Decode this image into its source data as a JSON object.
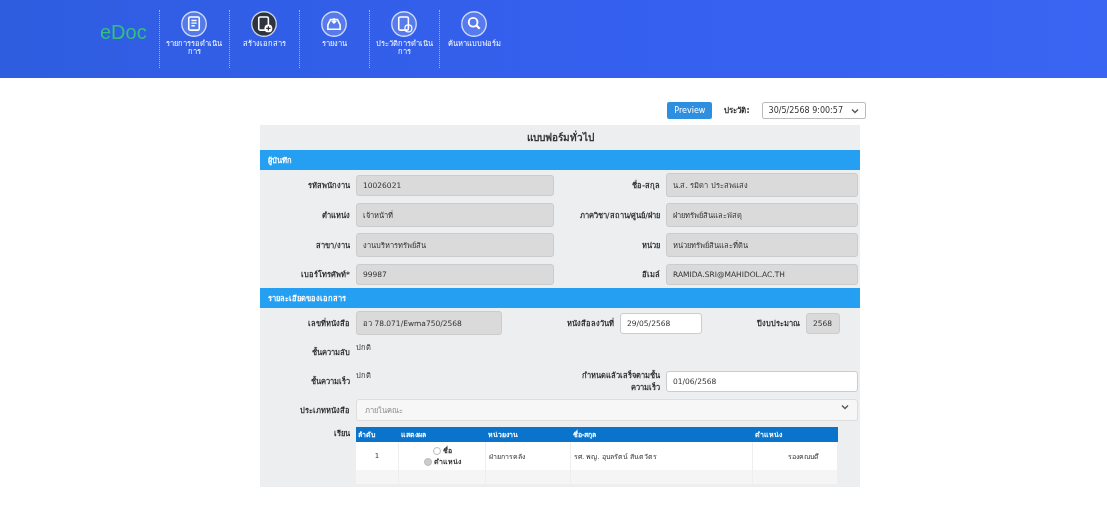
{
  "header": {
    "logo": "eDoc",
    "nav": [
      {
        "label": "รายการรอดำเนินการ",
        "selected": false
      },
      {
        "label": "สร้างเอกสาร",
        "selected": true
      },
      {
        "label": "รายงาน",
        "selected": false
      },
      {
        "label": "ประวัติการดำเนินการ",
        "selected": false
      },
      {
        "label": "ค้นหาแบบฟอร์ม",
        "selected": false
      }
    ]
  },
  "toolbar": {
    "preview_button": "Preview",
    "history_label": "ประวัติ:",
    "history_value": "30/5/2568 9:00:57"
  },
  "form": {
    "title": "แบบฟอร์มทั่วไป",
    "sections": [
      {
        "heading": "ผู้บันทึก",
        "rows": [
          {
            "kind": "fields",
            "items": [
              {
                "label": "รหัสพนักงาน",
                "value": "10026021",
                "kind": "readonly"
              },
              {
                "label": "ชื่อ-สกุล",
                "value": "น.ส. รมิดา ประสพแสง",
                "kind": "readonly"
              }
            ]
          },
          {
            "kind": "fields",
            "items": [
              {
                "label": "ตำแหน่ง",
                "value": "เจ้าหน้าที่",
                "kind": "readonly"
              },
              {
                "label": "ภาควิชา/สถาน/ศูนย์/ฝ่าย",
                "value": "ฝ่ายทรัพย์สินและพัสดุ",
                "kind": "readonly"
              }
            ]
          },
          {
            "kind": "fields",
            "items": [
              {
                "label": "สาขา/งาน",
                "value": "งานบริหารทรัพย์สิน",
                "kind": "readonly"
              },
              {
                "label": "หน่วย",
                "value": "หน่วยทรัพย์สินและที่ดิน",
                "kind": "readonly"
              }
            ]
          },
          {
            "kind": "fields",
            "items": [
              {
                "label": "เบอร์โทรศัพท์*",
                "value": "99987",
                "kind": "readonly"
              },
              {
                "label": "อีเมล์",
                "value": "RAMIDA.SRI@MAHIDOL.AC.TH",
                "kind": "readonly"
              }
            ]
          }
        ]
      },
      {
        "heading": "รายละเอียดของเอกสาร",
        "rows": [
          {
            "kind": "fields3",
            "items": [
              {
                "label": "เลขที่หนังสือ",
                "value": "อว 78.071/Ewma750/2568",
                "kind": "readonly"
              },
              {
                "label": "หนังสือลงวันที่",
                "value": "29/05/2568",
                "kind": "input"
              },
              {
                "label": "ปีงบประมาณ",
                "value": "2568",
                "kind": "readonly"
              }
            ]
          },
          {
            "kind": "fields",
            "items": [
              {
                "label": "ชั้นความลับ",
                "value": "ปกติ",
                "kind": "plain"
              }
            ]
          },
          {
            "kind": "fields",
            "items": [
              {
                "label": "ชั้นความเร็ว",
                "value": "ปกติ",
                "kind": "plain"
              },
              {
                "label": "กำหนดแล้วเสร็จตามชั้นความเร็ว",
                "value": "01/06/2568",
                "kind": "input"
              }
            ]
          },
          {
            "kind": "select",
            "label": "ประเภทหนังสือ",
            "value": "ภายในคณะ",
            "disabled": true
          },
          {
            "kind": "table",
            "label": "เรียน",
            "columns": [
              "ลำดับ",
              "แสดงผล",
              "หน่วยงาน",
              "ชื่อ-สกุล",
              "ตำแหน่ง"
            ],
            "rows": [
              {
                "number": "1",
                "options": [
                  {
                    "label": "ชื่อ",
                    "selected": false
                  },
                  {
                    "label": "ตำแหน่ง",
                    "selected": true
                  }
                ],
                "department": "ฝ่ายการคลัง",
                "name": "รศ. พญ. อุบลรัตน์ สันตวัตร",
                "position": "รองคณบดี"
              }
            ]
          }
        ]
      }
    ]
  }
}
